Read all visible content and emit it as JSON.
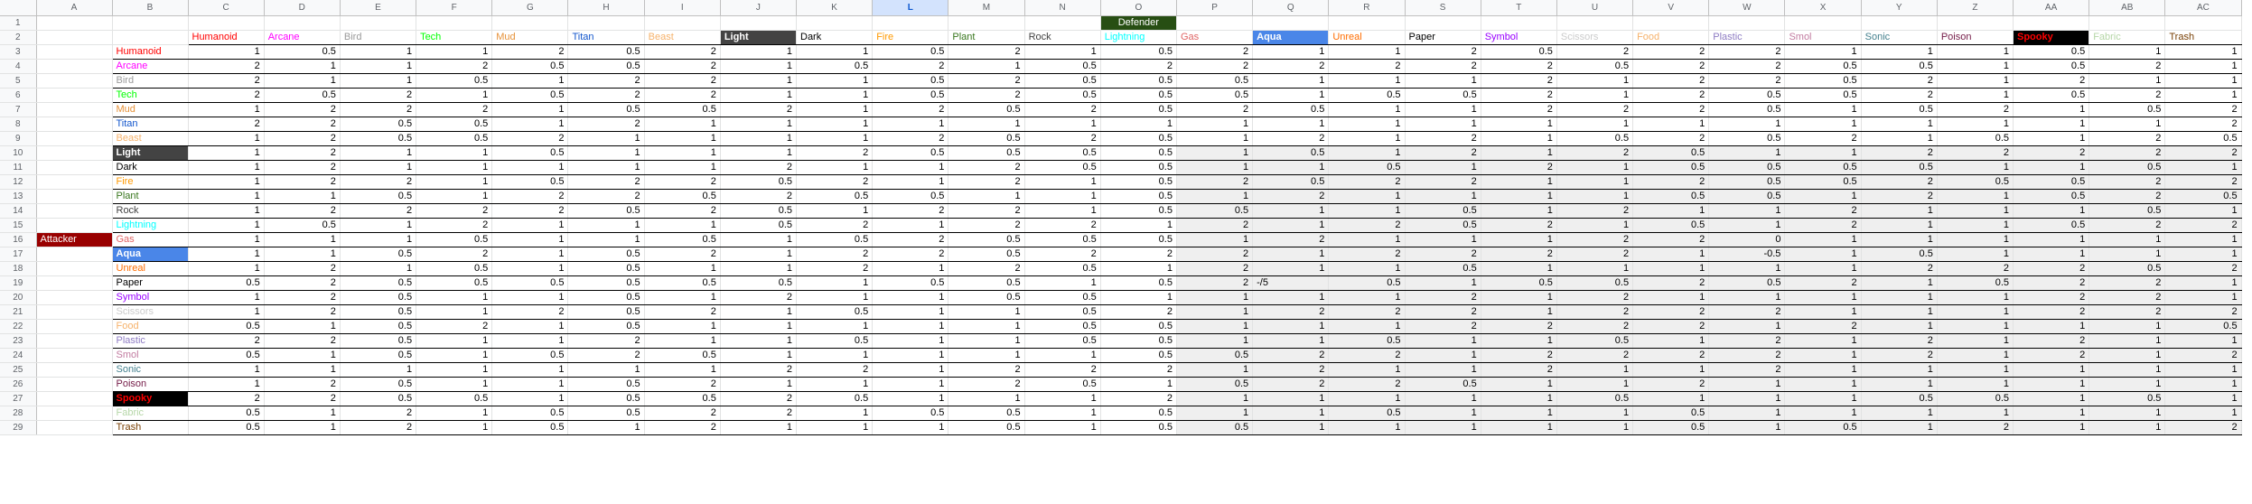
{
  "sheet": {
    "columns": [
      "A",
      "B",
      "C",
      "D",
      "E",
      "F",
      "G",
      "H",
      "I",
      "J",
      "K",
      "L",
      "M",
      "N",
      "O",
      "P",
      "Q",
      "R",
      "S",
      "T",
      "U",
      "V",
      "W",
      "X",
      "Y",
      "Z",
      "AA",
      "AB",
      "AC"
    ],
    "selected_column": "L",
    "defender_label": "Defender",
    "attacker_label": "Attacker",
    "types": [
      {
        "name": "Humanoid",
        "color": "#ff0000"
      },
      {
        "name": "Arcane",
        "color": "#ff00ff"
      },
      {
        "name": "Bird",
        "color": "#999999"
      },
      {
        "name": "Tech",
        "color": "#00ff00"
      },
      {
        "name": "Mud",
        "color": "#e69138"
      },
      {
        "name": "Titan",
        "color": "#1155cc"
      },
      {
        "name": "Beast",
        "color": "#f6b26b"
      },
      {
        "name": "Light",
        "color": "#ffffff",
        "bg": "#434343"
      },
      {
        "name": "Dark",
        "color": "#000000"
      },
      {
        "name": "Fire",
        "color": "#ff9900"
      },
      {
        "name": "Plant",
        "color": "#38761d"
      },
      {
        "name": "Rock",
        "color": "#434343"
      },
      {
        "name": "Lightning",
        "color": "#00ffff"
      },
      {
        "name": "Gas",
        "color": "#e06666"
      },
      {
        "name": "Aqua",
        "color": "#ffffff",
        "bg": "#4a86e8"
      },
      {
        "name": "Unreal",
        "color": "#ff6d01"
      },
      {
        "name": "Paper",
        "color": "#000000"
      },
      {
        "name": "Symbol",
        "color": "#9900ff"
      },
      {
        "name": "Scissors",
        "color": "#cccccc"
      },
      {
        "name": "Food",
        "color": "#f6b26b"
      },
      {
        "name": "Plastic",
        "color": "#8e7cc3"
      },
      {
        "name": "Smol",
        "color": "#c27ba0"
      },
      {
        "name": "Sonic",
        "color": "#45818e"
      },
      {
        "name": "Poison",
        "color": "#741b47"
      },
      {
        "name": "Spooky",
        "color": "#ff0000",
        "bg": "#000000"
      },
      {
        "name": "Fabric",
        "color": "#b6d7a8"
      },
      {
        "name": "Trash",
        "color": "#783f04"
      }
    ],
    "matrix": [
      [
        "1",
        "0.5",
        "1",
        "1",
        "2",
        "0.5",
        "2",
        "1",
        "1",
        "0.5",
        "2",
        "1",
        "0.5",
        "2",
        "1",
        "1",
        "2",
        "0.5",
        "2",
        "2",
        "2",
        "1",
        "1",
        "1",
        "0.5",
        "1",
        "1"
      ],
      [
        "2",
        "1",
        "1",
        "2",
        "0.5",
        "0.5",
        "2",
        "1",
        "0.5",
        "2",
        "1",
        "0.5",
        "2",
        "2",
        "2",
        "2",
        "2",
        "2",
        "0.5",
        "2",
        "2",
        "0.5",
        "0.5",
        "1",
        "0.5",
        "2",
        "1"
      ],
      [
        "2",
        "1",
        "1",
        "0.5",
        "1",
        "2",
        "2",
        "1",
        "1",
        "0.5",
        "2",
        "0.5",
        "0.5",
        "0.5",
        "1",
        "1",
        "1",
        "2",
        "1",
        "2",
        "2",
        "0.5",
        "2",
        "1",
        "2",
        "1",
        "1"
      ],
      [
        "2",
        "0.5",
        "2",
        "1",
        "0.5",
        "2",
        "2",
        "1",
        "1",
        "0.5",
        "2",
        "0.5",
        "0.5",
        "0.5",
        "1",
        "0.5",
        "0.5",
        "2",
        "1",
        "2",
        "0.5",
        "0.5",
        "2",
        "1",
        "0.5",
        "2",
        "1"
      ],
      [
        "1",
        "2",
        "2",
        "2",
        "1",
        "0.5",
        "0.5",
        "2",
        "1",
        "2",
        "0.5",
        "2",
        "0.5",
        "2",
        "0.5",
        "1",
        "1",
        "2",
        "2",
        "2",
        "0.5",
        "1",
        "0.5",
        "2",
        "1",
        "0.5",
        "2"
      ],
      [
        "2",
        "2",
        "0.5",
        "0.5",
        "1",
        "2",
        "1",
        "1",
        "1",
        "1",
        "1",
        "1",
        "1",
        "1",
        "1",
        "1",
        "1",
        "1",
        "1",
        "1",
        "1",
        "1",
        "1",
        "1",
        "1",
        "1",
        "2"
      ],
      [
        "1",
        "2",
        "0.5",
        "0.5",
        "2",
        "1",
        "1",
        "1",
        "1",
        "2",
        "0.5",
        "2",
        "0.5",
        "1",
        "2",
        "1",
        "2",
        "1",
        "0.5",
        "2",
        "0.5",
        "2",
        "1",
        "0.5",
        "1",
        "2",
        "0.5"
      ],
      [
        "1",
        "2",
        "1",
        "1",
        "0.5",
        "1",
        "1",
        "1",
        "2",
        "0.5",
        "0.5",
        "0.5",
        "0.5",
        "1",
        "0.5",
        "1",
        "2",
        "1",
        "2",
        "0.5",
        "1",
        "1",
        "2",
        "2",
        "2",
        "2",
        "2"
      ],
      [
        "1",
        "2",
        "1",
        "1",
        "1",
        "1",
        "1",
        "2",
        "1",
        "1",
        "2",
        "0.5",
        "0.5",
        "1",
        "1",
        "0.5",
        "1",
        "2",
        "1",
        "0.5",
        "0.5",
        "0.5",
        "0.5",
        "1",
        "1",
        "0.5",
        "1"
      ],
      [
        "1",
        "2",
        "2",
        "1",
        "0.5",
        "2",
        "2",
        "0.5",
        "2",
        "1",
        "2",
        "1",
        "0.5",
        "2",
        "0.5",
        "2",
        "2",
        "1",
        "1",
        "2",
        "0.5",
        "0.5",
        "2",
        "0.5",
        "0.5",
        "2",
        "2"
      ],
      [
        "1",
        "1",
        "0.5",
        "1",
        "2",
        "2",
        "0.5",
        "2",
        "0.5",
        "0.5",
        "1",
        "1",
        "0.5",
        "1",
        "2",
        "1",
        "1",
        "1",
        "1",
        "0.5",
        "0.5",
        "1",
        "2",
        "1",
        "0.5",
        "2",
        "0.5"
      ],
      [
        "1",
        "2",
        "2",
        "2",
        "2",
        "0.5",
        "2",
        "0.5",
        "1",
        "2",
        "2",
        "1",
        "0.5",
        "0.5",
        "1",
        "1",
        "0.5",
        "1",
        "2",
        "1",
        "1",
        "2",
        "1",
        "1",
        "1",
        "0.5",
        "1"
      ],
      [
        "1",
        "0.5",
        "1",
        "2",
        "1",
        "1",
        "1",
        "0.5",
        "2",
        "1",
        "2",
        "2",
        "1",
        "2",
        "1",
        "2",
        "0.5",
        "2",
        "1",
        "0.5",
        "1",
        "2",
        "1",
        "1",
        "0.5",
        "2",
        "2"
      ],
      [
        "1",
        "1",
        "1",
        "0.5",
        "1",
        "1",
        "0.5",
        "1",
        "0.5",
        "2",
        "0.5",
        "0.5",
        "0.5",
        "1",
        "2",
        "1",
        "1",
        "1",
        "2",
        "2",
        "0",
        "1",
        "1",
        "1",
        "1",
        "1",
        "1"
      ],
      [
        "1",
        "1",
        "0.5",
        "2",
        "1",
        "0.5",
        "2",
        "1",
        "2",
        "2",
        "0.5",
        "2",
        "2",
        "2",
        "1",
        "2",
        "2",
        "2",
        "2",
        "1",
        "-0.5",
        "1",
        "0.5",
        "1",
        "1",
        "1",
        "1"
      ],
      [
        "1",
        "2",
        "1",
        "0.5",
        "1",
        "0.5",
        "1",
        "1",
        "2",
        "1",
        "2",
        "0.5",
        "1",
        "2",
        "1",
        "1",
        "0.5",
        "1",
        "1",
        "1",
        "1",
        "1",
        "2",
        "2",
        "2",
        "0.5",
        "2"
      ],
      [
        "0.5",
        "2",
        "0.5",
        "0.5",
        "0.5",
        "0.5",
        "0.5",
        "0.5",
        "1",
        "0.5",
        "0.5",
        "1",
        "0.5",
        "2",
        "-/5",
        "0.5",
        "1",
        "0.5",
        "0.5",
        "2",
        "0.5",
        "2",
        "1",
        "0.5",
        "2",
        "2",
        "1"
      ],
      [
        "1",
        "2",
        "0.5",
        "1",
        "1",
        "0.5",
        "1",
        "2",
        "1",
        "1",
        "0.5",
        "0.5",
        "1",
        "1",
        "1",
        "1",
        "2",
        "1",
        "2",
        "1",
        "1",
        "1",
        "1",
        "1",
        "2",
        "2",
        "1"
      ],
      [
        "1",
        "2",
        "0.5",
        "1",
        "2",
        "0.5",
        "2",
        "1",
        "0.5",
        "1",
        "1",
        "0.5",
        "2",
        "1",
        "2",
        "2",
        "2",
        "1",
        "2",
        "2",
        "2",
        "1",
        "1",
        "1",
        "2",
        "2",
        "2"
      ],
      [
        "0.5",
        "1",
        "0.5",
        "2",
        "1",
        "0.5",
        "1",
        "1",
        "1",
        "1",
        "1",
        "0.5",
        "0.5",
        "1",
        "1",
        "1",
        "2",
        "2",
        "2",
        "2",
        "1",
        "2",
        "1",
        "1",
        "1",
        "1",
        "0.5"
      ],
      [
        "2",
        "2",
        "0.5",
        "1",
        "1",
        "2",
        "1",
        "1",
        "0.5",
        "1",
        "1",
        "0.5",
        "0.5",
        "1",
        "1",
        "0.5",
        "1",
        "1",
        "0.5",
        "1",
        "2",
        "1",
        "2",
        "1",
        "2",
        "1",
        "1"
      ],
      [
        "0.5",
        "1",
        "0.5",
        "1",
        "0.5",
        "2",
        "0.5",
        "1",
        "1",
        "1",
        "1",
        "1",
        "0.5",
        "0.5",
        "2",
        "2",
        "1",
        "2",
        "2",
        "2",
        "2",
        "1",
        "2",
        "1",
        "2",
        "1",
        "2"
      ],
      [
        "1",
        "1",
        "1",
        "1",
        "1",
        "1",
        "1",
        "2",
        "2",
        "1",
        "2",
        "2",
        "2",
        "1",
        "2",
        "1",
        "1",
        "2",
        "1",
        "1",
        "2",
        "1",
        "1",
        "1",
        "1",
        "1",
        "1"
      ],
      [
        "1",
        "2",
        "0.5",
        "1",
        "1",
        "0.5",
        "2",
        "1",
        "1",
        "1",
        "2",
        "0.5",
        "1",
        "0.5",
        "2",
        "2",
        "0.5",
        "1",
        "1",
        "2",
        "1",
        "1",
        "1",
        "1",
        "1",
        "1",
        "1"
      ],
      [
        "2",
        "2",
        "0.5",
        "0.5",
        "1",
        "0.5",
        "0.5",
        "2",
        "0.5",
        "1",
        "1",
        "1",
        "2",
        "1",
        "1",
        "1",
        "1",
        "1",
        "0.5",
        "1",
        "1",
        "1",
        "0.5",
        "0.5",
        "1",
        "0.5",
        "1"
      ],
      [
        "0.5",
        "1",
        "2",
        "1",
        "0.5",
        "0.5",
        "2",
        "2",
        "1",
        "0.5",
        "0.5",
        "1",
        "0.5",
        "1",
        "1",
        "0.5",
        "1",
        "1",
        "1",
        "0.5",
        "1",
        "1",
        "1",
        "1",
        "1",
        "1",
        "1"
      ],
      [
        "0.5",
        "1",
        "2",
        "1",
        "0.5",
        "1",
        "2",
        "1",
        "1",
        "1",
        "0.5",
        "1",
        "0.5",
        "0.5",
        "1",
        "1",
        "1",
        "1",
        "1",
        "0.5",
        "1",
        "0.5",
        "1",
        "2",
        "1",
        "1",
        "2"
      ]
    ]
  }
}
